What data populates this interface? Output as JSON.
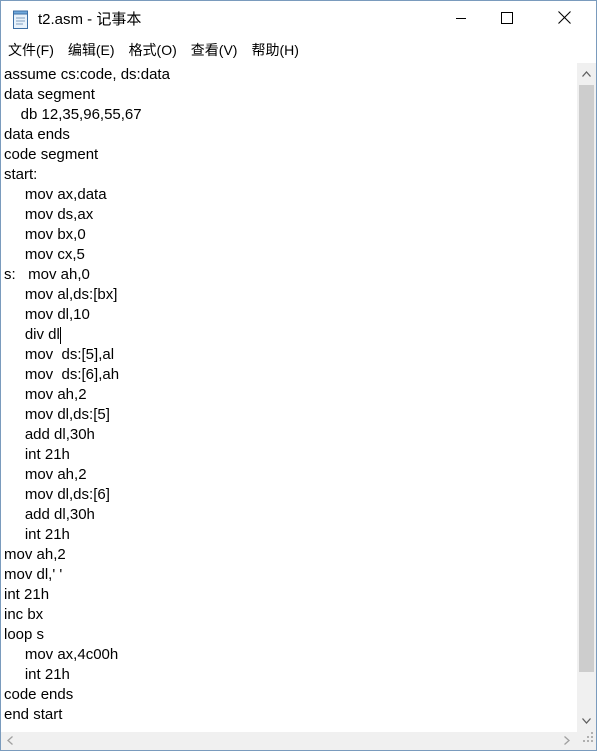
{
  "window": {
    "title": "t2.asm - 记事本",
    "app_icon": "notepad-icon"
  },
  "window_controls": {
    "minimize_icon": "minimize-icon",
    "maximize_icon": "maximize-icon",
    "close_icon": "close-icon"
  },
  "menu": {
    "items": [
      {
        "label": "文件(F)"
      },
      {
        "label": "编辑(E)"
      },
      {
        "label": "格式(O)"
      },
      {
        "label": "查看(V)"
      },
      {
        "label": "帮助(H)"
      }
    ]
  },
  "editor": {
    "lines": [
      "assume cs:code, ds:data",
      "data segment",
      "    db 12,35,96,55,67",
      "data ends",
      "code segment",
      "start:",
      "     mov ax,data",
      "     mov ds,ax",
      "     mov bx,0",
      "     mov cx,5",
      "s:   mov ah,0",
      "     mov al,ds:[bx]",
      "     mov dl,10",
      "     div dl",
      "     mov  ds:[5],al",
      "     mov  ds:[6],ah",
      "     mov ah,2",
      "     mov dl,ds:[5]",
      "     add dl,30h",
      "     int 21h",
      "     mov ah,2",
      "     mov dl,ds:[6]",
      "     add dl,30h",
      "     int 21h",
      "mov ah,2",
      "mov dl,' '",
      "int 21h",
      "inc bx",
      "loop s",
      "     mov ax,4c00h",
      "     int 21h",
      "code ends",
      "end start"
    ],
    "caret_line": 13
  },
  "scrollbars": {
    "up_icon": "scroll-up-arrow-icon",
    "down_icon": "scroll-down-arrow-icon",
    "left_icon": "scroll-left-arrow-icon",
    "right_icon": "scroll-right-arrow-icon"
  }
}
